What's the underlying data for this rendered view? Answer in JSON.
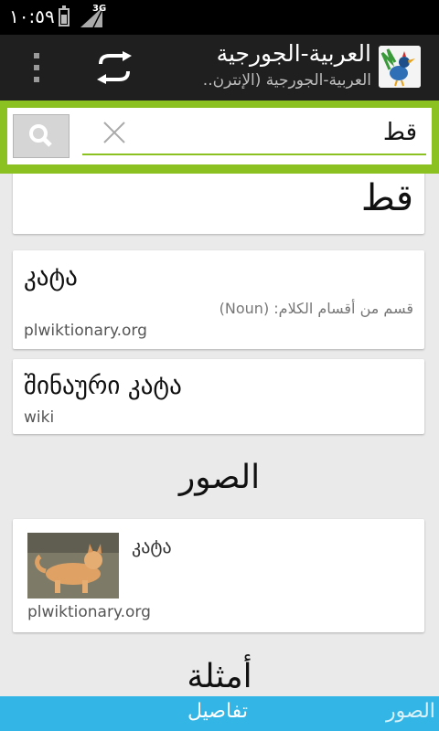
{
  "status_bar": {
    "time": "١٠:٥٩",
    "network": "3G"
  },
  "action_bar": {
    "title": "العربية-الجورجية",
    "subtitle": "العربية-الجورجية (الإنترن..",
    "menu_icon": "overflow-menu-icon",
    "sync_icon": "swap-direction-icon",
    "logo_icon": "rooster-logo-icon"
  },
  "search": {
    "value": "قط",
    "button_icon": "search-icon",
    "clear_icon": "close-icon"
  },
  "results": {
    "headword": "قط",
    "translations": [
      {
        "term": "კატა",
        "pos": "قسم من أقسام الكلام: (Noun)",
        "source": "plwiktionary.org"
      },
      {
        "term": "შინაური კატა",
        "source": "wiki"
      }
    ]
  },
  "images_section": {
    "title": "الصور",
    "items": [
      {
        "caption": "კატა",
        "source": "plwiktionary.org"
      }
    ]
  },
  "examples_section": {
    "title": "أمثلة"
  },
  "bottom_tabs": {
    "details": "تفاصيل",
    "images": "الصور"
  },
  "colors": {
    "accent_green": "#8bc120",
    "tab_blue": "#33b5e5",
    "action_bar": "#1f1f1f"
  }
}
